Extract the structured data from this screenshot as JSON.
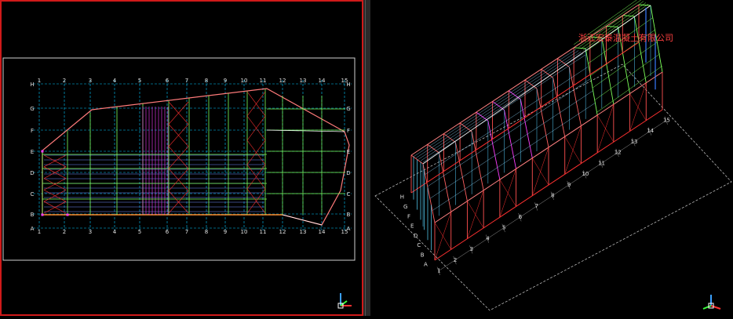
{
  "plan_view": {
    "column_labels": [
      "1",
      "2",
      "3",
      "4",
      "5",
      "6",
      "7",
      "8",
      "9",
      "10",
      "11",
      "12",
      "13",
      "14",
      "15"
    ],
    "row_labels": [
      "A",
      "B",
      "C",
      "D",
      "E",
      "F",
      "G",
      "H"
    ]
  },
  "model_view": {
    "company_name": "浙江宏泰混凝土有限公司",
    "row_labels": [
      "A",
      "B",
      "C",
      "D",
      "E",
      "F",
      "G",
      "H"
    ],
    "column_labels": [
      "1",
      "2",
      "3",
      "4",
      "5",
      "6",
      "7",
      "8",
      "9",
      "10",
      "11",
      "12",
      "13",
      "14",
      "15"
    ]
  },
  "colors": {
    "viewport_active_border": "#d01a1a",
    "grid": "#00c8ff",
    "roof_outline": "#ff7a7a",
    "steel_green": "#7cff5a",
    "steel_magenta": "#ff3cff",
    "brace_red": "#ff3030",
    "company_text": "#ff4040"
  },
  "icons": [
    "ucs-axis-icon-left",
    "ucs-axis-icon-right"
  ]
}
